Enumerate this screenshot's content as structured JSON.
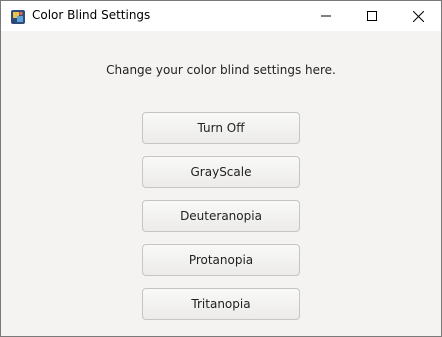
{
  "window": {
    "title": "Color Blind Settings",
    "app_icon": "color-palette-icon",
    "controls": [
      "minimize-icon",
      "maximize-icon",
      "close-icon"
    ]
  },
  "main": {
    "message": "Change your color blind settings here.",
    "buttons": [
      {
        "label": "Turn Off"
      },
      {
        "label": "GrayScale"
      },
      {
        "label": "Deuteranopia"
      },
      {
        "label": "Protanopia"
      },
      {
        "label": "Tritanopia"
      }
    ]
  }
}
